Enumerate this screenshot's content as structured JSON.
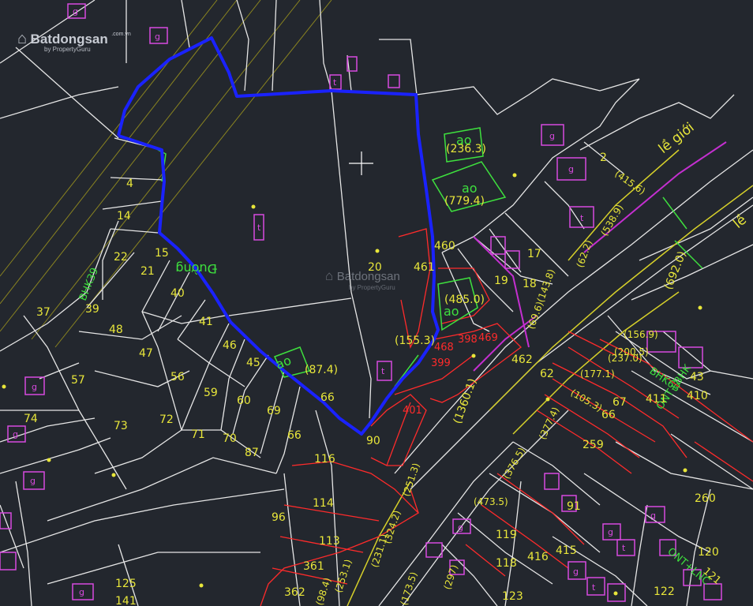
{
  "watermark": {
    "brand": "Batdongsan",
    "suffix": ".com.vn",
    "by": "by PropertyGuru",
    "center_brand": "Batdongsan",
    "center_by": "by PropertyGuru"
  },
  "colors": {
    "background": "#23272e",
    "boundary": "#1a22ff",
    "parcel_lines": "#e6e6e6",
    "labels": "#e8e63a",
    "land_type": "#3ee03e",
    "new_parcels": "#ff2b2b",
    "symbols": "#d84adf"
  },
  "road_labels": {
    "main_road": "lề giới",
    "road_right": "lề",
    "vertical_road": "Đường"
  },
  "highlight": {
    "pond_label": "ao",
    "pond_area": "(87.4)",
    "area_a": "(236.3)",
    "area_b": "(779.4)",
    "area_c": "(485.0)",
    "area_d": "(155.3)",
    "area_e": "(692.0)",
    "area_f": "(1360.1)"
  },
  "parcel_numbers": {
    "n4": "4",
    "n14": "14",
    "n15": "15",
    "n21": "21",
    "n22": "22",
    "n37": "37",
    "n39": "39",
    "n48": "48",
    "n40": "40",
    "n41": "41",
    "n46": "46",
    "n45": "45",
    "n47": "47",
    "n56": "56",
    "n57": "57",
    "n59": "59",
    "n60": "60",
    "n69": "69",
    "n66a": "66",
    "n66b": "66",
    "n72": "72",
    "n71": "71",
    "n70": "70",
    "n87": "87",
    "n73": "73",
    "n74": "74",
    "n20": "20",
    "n461": "461",
    "n460": "460",
    "n90": "90",
    "n116": "116",
    "n114": "114",
    "n113": "113",
    "n361": "361",
    "n362": "362",
    "n96": "96",
    "n125": "125",
    "n141": "141",
    "n462": "462",
    "n62": "62",
    "n19": "19",
    "n18": "18",
    "n17": "17",
    "n2": "2",
    "n43": "43",
    "n410": "410",
    "n260": "260",
    "n91": "91",
    "n415": "415",
    "n416": "416",
    "n119": "119",
    "n118": "118",
    "n123": "123",
    "n122": "122",
    "n120": "120",
    "n401": "401",
    "n468": "468",
    "n399": "399",
    "n398": "398",
    "n469": "469",
    "n411": "411",
    "n67": "67",
    "n66c": "66",
    "n259": "259"
  },
  "dims": {
    "d1": "(415.6)",
    "d2": "(538.9)",
    "d3": "(62.2)",
    "d4": "(143.8)",
    "d5": "(69.6)",
    "d6": "(156.9)",
    "d7": "(200.5)",
    "d8": "(237.0)",
    "d9": "(177.1)",
    "d10": "(105.3)",
    "d11": "(377.4)",
    "d12": "(376.5)",
    "d13": "(473.5)",
    "d14": "(251.3)",
    "d15": "(231.1)",
    "d16": "(324.2)",
    "d17": "(253.1)",
    "d18": "(297)",
    "d19": "(173.5)",
    "d20": "(98.4)"
  },
  "codes": {
    "bhk1": "BHK39",
    "bhk2": "BHK63",
    "ont1": "ONT+BHK",
    "ont2": "ONT+LNC",
    "ont3": "121",
    "lnc": "LNC"
  },
  "symbols": {
    "g": "g",
    "t": "t"
  }
}
